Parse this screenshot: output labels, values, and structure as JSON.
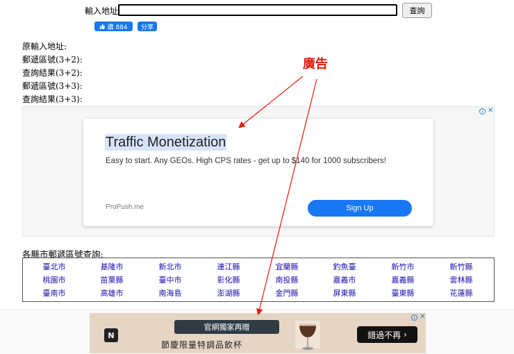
{
  "search": {
    "label": "輸入地址:",
    "value": "",
    "button": "查詢"
  },
  "social": {
    "like_label": "讚 884",
    "share_label": "分享"
  },
  "results": [
    "原輸入地址:",
    "郵遞區號(3+2):",
    "查詢結果(3+2):",
    "郵遞區號(3+3):",
    "查詢結果(3+3):"
  ],
  "annotation": "廣告",
  "ad1": {
    "title": "Traffic Monetization",
    "description": "Easy to start. Any GEOs. High CPS rates - get up to $140 for 1000 subscribers!",
    "brand": "ProPush.me",
    "cta": "Sign Up"
  },
  "counties": {
    "heading": "各縣市郵遞區號查詢:",
    "rows": [
      [
        "臺北市",
        "基隆市",
        "新北市",
        "連江縣",
        "宜蘭縣",
        "釣魚臺",
        "新竹市",
        "新竹縣"
      ],
      [
        "桃園市",
        "苗栗縣",
        "臺中市",
        "彰化縣",
        "南投縣",
        "嘉義市",
        "嘉義縣",
        "雲林縣"
      ],
      [
        "臺南市",
        "高雄市",
        "南海島",
        "澎湖縣",
        "金門縣",
        "屏東縣",
        "臺東縣",
        "花蓮縣"
      ]
    ]
  },
  "ad2": {
    "logo": "N",
    "headline": "官網獨家再贈",
    "subline": "節慶限量特調品飲杯",
    "cta": "錯過不再"
  },
  "colors": {
    "link": "#1a0dab",
    "facebook": "#1877f2",
    "annotation": "#e31b0c"
  }
}
